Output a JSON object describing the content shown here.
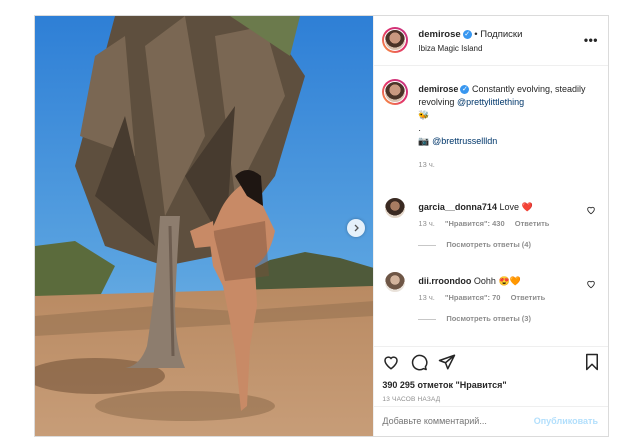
{
  "post": {
    "username": "demirose",
    "follow_label": "• Подписки",
    "location": "Ibiza Magic Island",
    "caption": {
      "text_before": "Constantly evolving, steadily revolving",
      "mention": "@prettylittlething",
      "emoji": "🐝",
      "dot": ".",
      "camera_emoji": "📷",
      "credit": "@brettrussellldn",
      "time": "13 ч."
    },
    "comments": [
      {
        "username": "garcia__donna714",
        "text": "Love ❤️",
        "time": "13 ч.",
        "likes": "\"Нравится\": 430",
        "reply": "Ответить",
        "view_replies": "Посмотреть ответы (4)"
      },
      {
        "username": "dii.rroondoo",
        "text": "Oohh 😍🧡",
        "time": "13 ч.",
        "likes": "\"Нравится\": 70",
        "reply": "Ответить",
        "view_replies": "Посмотреть ответы (3)"
      }
    ],
    "likes_count": "390 295 отметок \"Нравится\"",
    "posted_ago": "13 ЧАСОВ НАЗАД",
    "add_comment_placeholder": "Добавьте комментарий...",
    "publish_label": "Опубликовать"
  },
  "colors": {
    "link": "#00376b",
    "verified": "#3897f0",
    "heart": "#ed4956",
    "muted": "#8e8e8e",
    "publish_disabled": "#b2dffc"
  },
  "icons": {
    "header_more": "more-horizontal-icon",
    "like": "heart-icon",
    "comment": "comment-bubble-icon",
    "share": "paper-plane-icon",
    "save": "bookmark-icon",
    "next": "chevron-right-icon"
  }
}
